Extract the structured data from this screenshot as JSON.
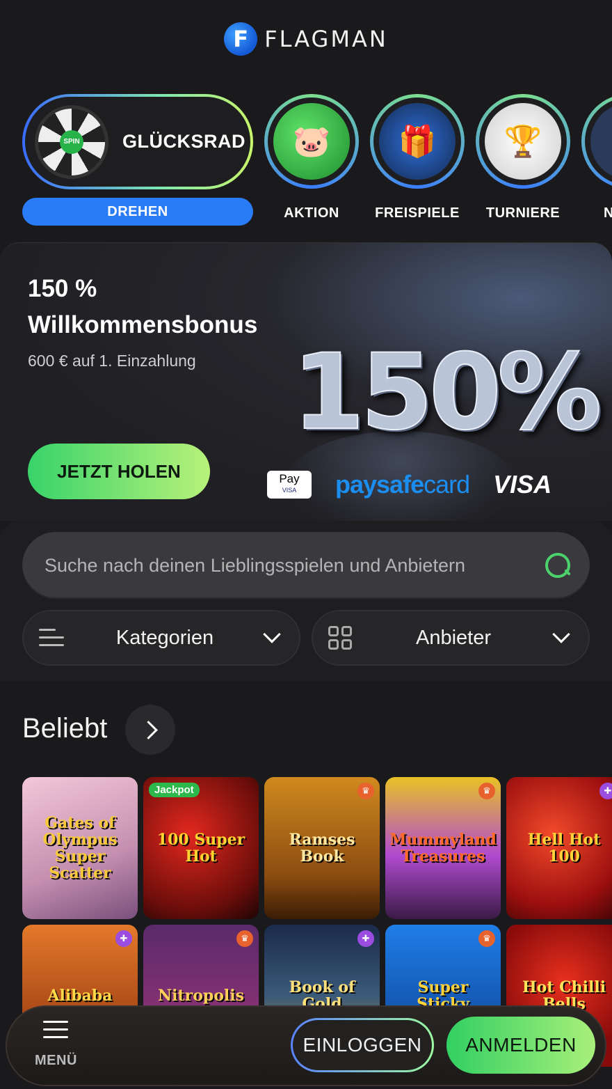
{
  "header": {
    "logo_letter": "F",
    "logo_text": "FLAGMAN"
  },
  "stories": {
    "wheel": {
      "title": "GLÜCKSRAD",
      "button": "DREHEN",
      "center": "SPIN"
    },
    "items": [
      {
        "label": "AKTION",
        "icon": "piggy-bank-icon"
      },
      {
        "label": "FREISPIELE",
        "icon": "gift-box-icon"
      },
      {
        "label": "TURNIERE",
        "icon": "trophy-icon"
      },
      {
        "label": "N",
        "icon": "partial-icon"
      }
    ]
  },
  "banner": {
    "title_line1": "150 %",
    "title_line2": "Willkommensbonus",
    "subtitle": "600 € auf 1. Einzahlung",
    "cta": "JETZT HOLEN",
    "big_text": "150%",
    "payments": {
      "applepay": "Pay",
      "applepay_sub": "VISA",
      "paysafe_bold": "paysafe",
      "paysafe_light": "card",
      "visa": "VISA"
    }
  },
  "search": {
    "placeholder": "Suche nach deinen Lieblingsspielen und Anbietern"
  },
  "filters": {
    "categories": "Kategorien",
    "providers": "Anbieter"
  },
  "section": {
    "title": "Beliebt"
  },
  "games": [
    {
      "name": "Gates of Olympus Super Scatter",
      "badge": "",
      "icon": ""
    },
    {
      "name": "100 Super Hot",
      "badge": "Jackpot",
      "icon": ""
    },
    {
      "name": "Ramses Book",
      "badge": "",
      "icon": "trophy-icon"
    },
    {
      "name": "Mummyland Treasures",
      "badge": "",
      "icon": "trophy-icon"
    },
    {
      "name": "Hell Hot 100",
      "badge": "",
      "icon": "gift-icon"
    },
    {
      "name": "Alibaba",
      "badge": "",
      "icon": "gift-icon"
    },
    {
      "name": "Nitropolis",
      "badge": "",
      "icon": "trophy-icon"
    },
    {
      "name": "Book of Gold",
      "badge": "",
      "icon": "gift-icon"
    },
    {
      "name": "Super Sticky",
      "badge": "",
      "icon": "trophy-icon"
    },
    {
      "name": "Hot Chilli Bells",
      "badge": "",
      "icon": ""
    }
  ],
  "bottombar": {
    "menu": "MENÜ",
    "login": "EINLOGGEN",
    "register": "ANMELDEN"
  },
  "colors": {
    "accent_green": "#38d36a",
    "accent_blue": "#2a7cf6",
    "background": "#1a1a1c"
  }
}
